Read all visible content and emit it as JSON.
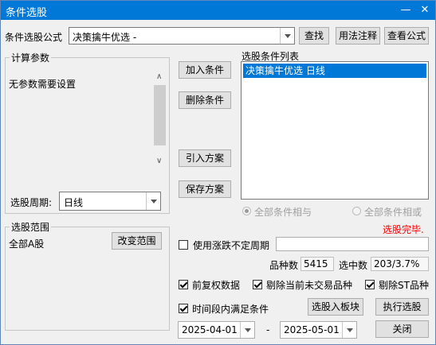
{
  "window": {
    "title": "条件选股",
    "minimize": "—",
    "close": "✕"
  },
  "formula": {
    "label": "条件选股公式",
    "value": "决策擒牛优选  -",
    "find": "查找",
    "usage": "用法注释",
    "view": "查看公式"
  },
  "params": {
    "legend": "计算参数",
    "message": "无参数需要设置"
  },
  "cycle": {
    "label": "选股周期:",
    "value": "日线"
  },
  "actions": {
    "add": "加入条件",
    "remove": "删除条件",
    "import": "引入方案",
    "save": "保存方案"
  },
  "conditions": {
    "legend": "选股条件列表",
    "items": [
      "决策擒牛优选  日线"
    ]
  },
  "logic": {
    "and_label": "全部条件相与",
    "or_label": "全部条件相或"
  },
  "status": {
    "text": "选股完毕.",
    "color": "#ff0000"
  },
  "range": {
    "legend": "选股范围",
    "value": "全部A股",
    "change": "改变范围"
  },
  "variable_period": {
    "label": "使用涨跌不定周期",
    "value": ""
  },
  "counts": {
    "total_label": "品种数",
    "total_value": "5415",
    "selected_label": "选中数",
    "selected_value": "203/3.7%"
  },
  "options": {
    "adjust": "前复权数据",
    "exclude_halted": "剔除当前未交易品种",
    "exclude_st": "剔除ST品种",
    "period_satisfy": "时间段内满足条件"
  },
  "buttons": {
    "to_block": "选股入板块",
    "execute": "执行选股",
    "close": "关闭"
  },
  "dates": {
    "start": "2025-04-01",
    "separator": "-",
    "end": "2025-05-01"
  }
}
